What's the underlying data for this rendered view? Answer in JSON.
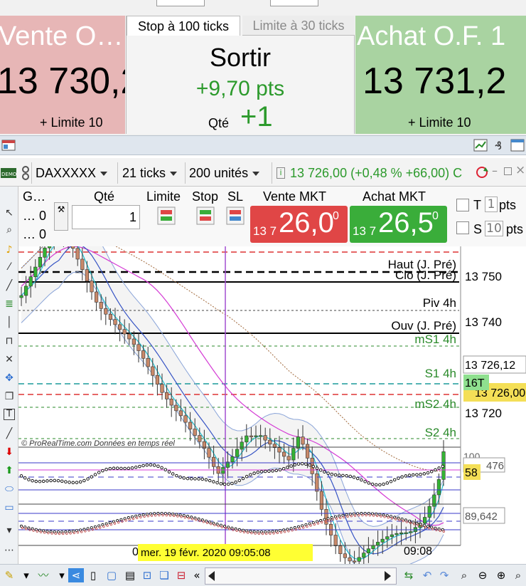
{
  "order_panel": {
    "sell": {
      "title": "Vente O…",
      "price": "13 730,2",
      "limit": "+ Limite 10"
    },
    "buy": {
      "title": "Achat O.F. 1",
      "price": "13 731,2",
      "limit": "+ Limite 10"
    },
    "tabs": [
      {
        "label": "Stop à 100 ticks"
      },
      {
        "label": "Limite à 30 ticks"
      }
    ],
    "exit": {
      "title": "Sortir",
      "pts": "+9,70 pts",
      "qty_label": "Qté",
      "qty_value": "+1"
    }
  },
  "toolbar": {
    "instrument": "DAXXXXX",
    "interval": "21 ticks",
    "units": "200 unités",
    "quote": "13 726,00 (+0,48 % +66,00) C"
  },
  "order_header": {
    "col_g": "G…",
    "g_vals": [
      "… 0",
      "… 0"
    ],
    "qty_label": "Qté",
    "qty_value": "1",
    "limit_label": "Limite",
    "stop_label": "Stop",
    "sl_label": "SL",
    "sell_mkt": {
      "label": "Vente MKT",
      "prefix": "13 7",
      "big": "26,0",
      "sup": "0"
    },
    "buy_mkt": {
      "label": "Achat MKT",
      "prefix": "13 7",
      "big": "26,5",
      "sup": "0"
    },
    "t_label": "T",
    "t_value": "1",
    "t_unit": "pts",
    "s_label": "S",
    "s_value": "10",
    "s_unit": "pts"
  },
  "chart": {
    "levels": [
      {
        "label": "Haut (J. Pré)"
      },
      {
        "label": "Clo (J. Pré)"
      },
      {
        "label": "Piv 4h"
      },
      {
        "label": "Ouv (J. Pré)"
      },
      {
        "label": "mS1 4h"
      },
      {
        "label": "S1 4h"
      },
      {
        "label": "mS2 4h"
      },
      {
        "label": "S2 4h"
      }
    ],
    "price_axis": [
      "13 750",
      "13 740",
      "13 720"
    ],
    "price_box_1": "13 726,12",
    "price_box_2": "13 726,00",
    "tick_box": "16T",
    "copyright": "© ProRealTime.com  Données en temps réel",
    "osc1_label": "58",
    "osc1_value": "476",
    "osc1_top": "100",
    "osc2_value": "89,642",
    "crosshair_date": "mer. 19 févr. 2020 09:05:08",
    "time_left": "0",
    "time_right": "09:08"
  },
  "colors": {
    "sell": "#e7b6b6",
    "buy": "#a9d3a1",
    "sell_btn": "#e04646",
    "buy_btn": "#3aad3a",
    "green_text": "#2c9a2c"
  }
}
